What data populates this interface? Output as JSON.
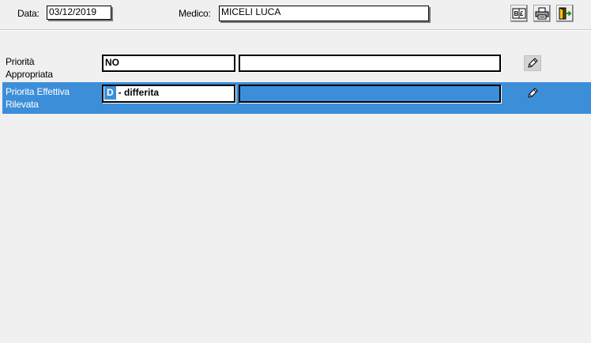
{
  "header": {
    "date_label": "Data:",
    "date_value": "03/12/2019",
    "doctor_label": "Medico:",
    "doctor_value": "MICELI LUCA"
  },
  "toolbar": {
    "buttons": [
      {
        "icon": "book-icon"
      },
      {
        "icon": "printer-icon"
      },
      {
        "icon": "exit-door-icon"
      }
    ]
  },
  "rows": [
    {
      "label_line1": "Priorità",
      "label_line2": "Appropriata",
      "value": "NO",
      "description": "",
      "selected": false
    },
    {
      "label_line1": "Priorita Effettiva",
      "label_line2": "Rilevata",
      "code": "D",
      "value": "- differita",
      "description": "",
      "selected": true
    }
  ],
  "colors": {
    "background": "#f0f0f0",
    "selection": "#3d8ed9",
    "field": "#ffffff"
  }
}
